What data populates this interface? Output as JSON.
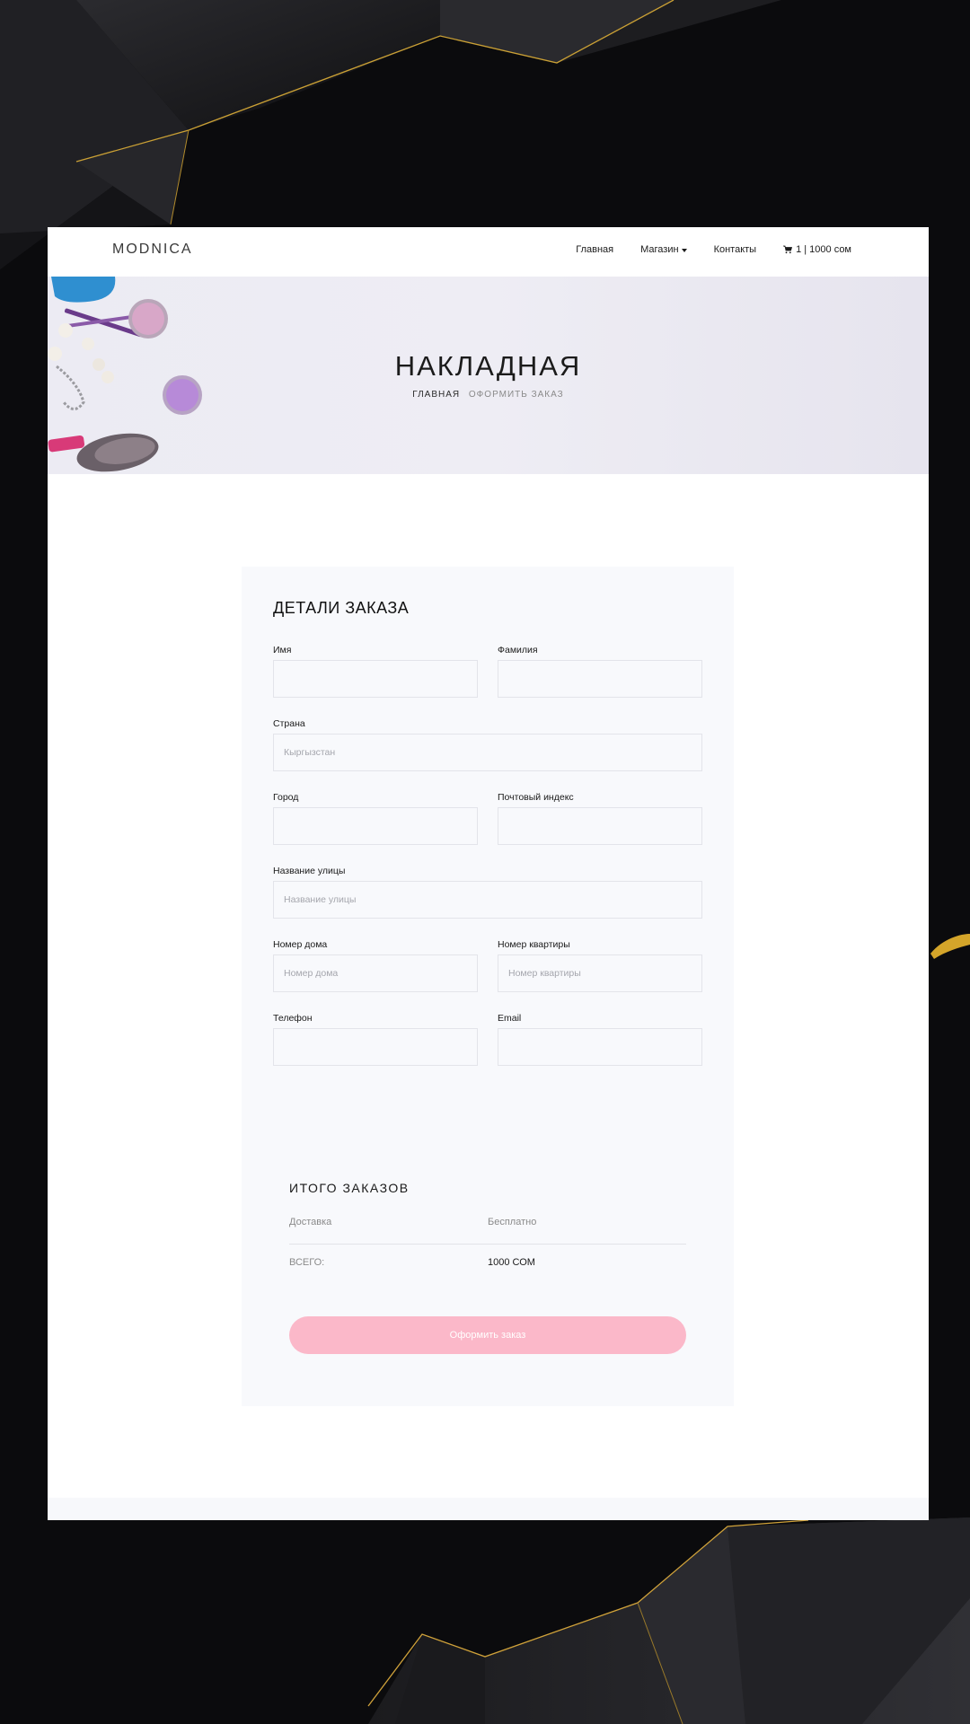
{
  "colors": {
    "accent_pink": "#fbb8c9",
    "panel_bg": "#f8f9fc",
    "dark_bg": "#0b0b0d",
    "gold_line": "#d4a52a"
  },
  "header": {
    "logo": "MODNICA",
    "nav": [
      {
        "label": "Главная"
      },
      {
        "label": "Магазин",
        "has_dropdown": true
      },
      {
        "label": "Контакты"
      }
    ],
    "cart": {
      "icon": "cart-icon",
      "text": "1 | 1000 сом"
    }
  },
  "hero": {
    "title": "НАКЛАДНАЯ",
    "breadcrumb_home": "ГЛАВНАЯ",
    "breadcrumb_current": "ОФОРМИТЬ ЗАКАЗ"
  },
  "form": {
    "title": "ДЕТАЛИ ЗАКАЗА",
    "first_name": {
      "label": "Имя",
      "value": "",
      "placeholder": ""
    },
    "last_name": {
      "label": "Фамилия",
      "value": "",
      "placeholder": ""
    },
    "country": {
      "label": "Страна",
      "value": "",
      "placeholder": "Кыргызстан"
    },
    "city": {
      "label": "Город",
      "value": "",
      "placeholder": ""
    },
    "postal_code": {
      "label": "Почтовый индекс",
      "value": "",
      "placeholder": ""
    },
    "street": {
      "label": "Название улицы",
      "value": "",
      "placeholder": "Название улицы"
    },
    "house": {
      "label": "Номер дома",
      "value": "",
      "placeholder": "Номер дома"
    },
    "apartment": {
      "label": "Номер квартиры",
      "value": "",
      "placeholder": "Номер квартиры"
    },
    "phone": {
      "label": "Телефон",
      "value": "",
      "placeholder": ""
    },
    "email": {
      "label": "Email",
      "value": "",
      "placeholder": ""
    }
  },
  "totals": {
    "title": "ИТОГО ЗАКАЗОВ",
    "delivery_label": "Доставка",
    "delivery_value": "Бесплатно",
    "total_label": "ВСЕГО:",
    "total_value": "1000 СОМ"
  },
  "submit_label": "Оформить заказ"
}
